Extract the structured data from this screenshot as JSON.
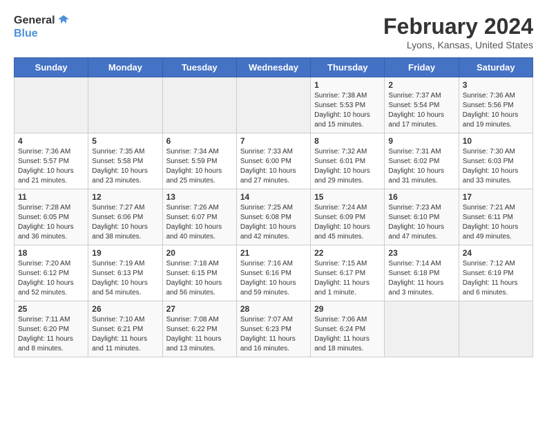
{
  "header": {
    "logo_line1": "General",
    "logo_line2": "Blue",
    "title": "February 2024",
    "subtitle": "Lyons, Kansas, United States"
  },
  "calendar": {
    "days_of_week": [
      "Sunday",
      "Monday",
      "Tuesday",
      "Wednesday",
      "Thursday",
      "Friday",
      "Saturday"
    ],
    "weeks": [
      [
        {
          "day": "",
          "info": ""
        },
        {
          "day": "",
          "info": ""
        },
        {
          "day": "",
          "info": ""
        },
        {
          "day": "",
          "info": ""
        },
        {
          "day": "1",
          "info": "Sunrise: 7:38 AM\nSunset: 5:53 PM\nDaylight: 10 hours\nand 15 minutes."
        },
        {
          "day": "2",
          "info": "Sunrise: 7:37 AM\nSunset: 5:54 PM\nDaylight: 10 hours\nand 17 minutes."
        },
        {
          "day": "3",
          "info": "Sunrise: 7:36 AM\nSunset: 5:56 PM\nDaylight: 10 hours\nand 19 minutes."
        }
      ],
      [
        {
          "day": "4",
          "info": "Sunrise: 7:36 AM\nSunset: 5:57 PM\nDaylight: 10 hours\nand 21 minutes."
        },
        {
          "day": "5",
          "info": "Sunrise: 7:35 AM\nSunset: 5:58 PM\nDaylight: 10 hours\nand 23 minutes."
        },
        {
          "day": "6",
          "info": "Sunrise: 7:34 AM\nSunset: 5:59 PM\nDaylight: 10 hours\nand 25 minutes."
        },
        {
          "day": "7",
          "info": "Sunrise: 7:33 AM\nSunset: 6:00 PM\nDaylight: 10 hours\nand 27 minutes."
        },
        {
          "day": "8",
          "info": "Sunrise: 7:32 AM\nSunset: 6:01 PM\nDaylight: 10 hours\nand 29 minutes."
        },
        {
          "day": "9",
          "info": "Sunrise: 7:31 AM\nSunset: 6:02 PM\nDaylight: 10 hours\nand 31 minutes."
        },
        {
          "day": "10",
          "info": "Sunrise: 7:30 AM\nSunset: 6:03 PM\nDaylight: 10 hours\nand 33 minutes."
        }
      ],
      [
        {
          "day": "11",
          "info": "Sunrise: 7:28 AM\nSunset: 6:05 PM\nDaylight: 10 hours\nand 36 minutes."
        },
        {
          "day": "12",
          "info": "Sunrise: 7:27 AM\nSunset: 6:06 PM\nDaylight: 10 hours\nand 38 minutes."
        },
        {
          "day": "13",
          "info": "Sunrise: 7:26 AM\nSunset: 6:07 PM\nDaylight: 10 hours\nand 40 minutes."
        },
        {
          "day": "14",
          "info": "Sunrise: 7:25 AM\nSunset: 6:08 PM\nDaylight: 10 hours\nand 42 minutes."
        },
        {
          "day": "15",
          "info": "Sunrise: 7:24 AM\nSunset: 6:09 PM\nDaylight: 10 hours\nand 45 minutes."
        },
        {
          "day": "16",
          "info": "Sunrise: 7:23 AM\nSunset: 6:10 PM\nDaylight: 10 hours\nand 47 minutes."
        },
        {
          "day": "17",
          "info": "Sunrise: 7:21 AM\nSunset: 6:11 PM\nDaylight: 10 hours\nand 49 minutes."
        }
      ],
      [
        {
          "day": "18",
          "info": "Sunrise: 7:20 AM\nSunset: 6:12 PM\nDaylight: 10 hours\nand 52 minutes."
        },
        {
          "day": "19",
          "info": "Sunrise: 7:19 AM\nSunset: 6:13 PM\nDaylight: 10 hours\nand 54 minutes."
        },
        {
          "day": "20",
          "info": "Sunrise: 7:18 AM\nSunset: 6:15 PM\nDaylight: 10 hours\nand 56 minutes."
        },
        {
          "day": "21",
          "info": "Sunrise: 7:16 AM\nSunset: 6:16 PM\nDaylight: 10 hours\nand 59 minutes."
        },
        {
          "day": "22",
          "info": "Sunrise: 7:15 AM\nSunset: 6:17 PM\nDaylight: 11 hours\nand 1 minute."
        },
        {
          "day": "23",
          "info": "Sunrise: 7:14 AM\nSunset: 6:18 PM\nDaylight: 11 hours\nand 3 minutes."
        },
        {
          "day": "24",
          "info": "Sunrise: 7:12 AM\nSunset: 6:19 PM\nDaylight: 11 hours\nand 6 minutes."
        }
      ],
      [
        {
          "day": "25",
          "info": "Sunrise: 7:11 AM\nSunset: 6:20 PM\nDaylight: 11 hours\nand 8 minutes."
        },
        {
          "day": "26",
          "info": "Sunrise: 7:10 AM\nSunset: 6:21 PM\nDaylight: 11 hours\nand 11 minutes."
        },
        {
          "day": "27",
          "info": "Sunrise: 7:08 AM\nSunset: 6:22 PM\nDaylight: 11 hours\nand 13 minutes."
        },
        {
          "day": "28",
          "info": "Sunrise: 7:07 AM\nSunset: 6:23 PM\nDaylight: 11 hours\nand 16 minutes."
        },
        {
          "day": "29",
          "info": "Sunrise: 7:06 AM\nSunset: 6:24 PM\nDaylight: 11 hours\nand 18 minutes."
        },
        {
          "day": "",
          "info": ""
        },
        {
          "day": "",
          "info": ""
        }
      ]
    ]
  }
}
